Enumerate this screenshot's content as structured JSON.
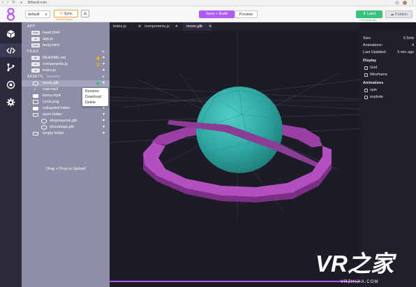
{
  "browser": {
    "url": "ilithwell.com",
    "nav_glyphs": [
      "‹",
      "›",
      "↻"
    ]
  },
  "toolbar": {
    "branch_select": "default",
    "sync_label": "Sync",
    "sync_subtext": "Needs Preview",
    "save_build_label": "Save + Build",
    "preview_label": "Preview",
    "land_label": "Land",
    "land_subtext": "x Five Branches",
    "publish_label": "Publish"
  },
  "rail": {
    "icons": [
      "cube-icon",
      "code-icon",
      "branch-icon",
      "target-icon",
      "gear-icon"
    ]
  },
  "panel": {
    "sections": {
      "app": "APP",
      "files": "FILES",
      "assets": "ASSETS",
      "assets_hint": "/assets/"
    },
    "app_files": [
      {
        "tag": "HTML",
        "name": "head.html"
      },
      {
        "tag": "JS",
        "name": "app.js"
      },
      {
        "tag": "HTML",
        "name": "body.html"
      }
    ],
    "files": [
      {
        "tag": "MD",
        "name": "README.md",
        "status_color": "#e8b21d"
      },
      {
        "tag": "JS",
        "name": "components.js",
        "status_color": "#e8b21d"
      },
      {
        "tag": "JS",
        "name": "index.js",
        "status_color": ""
      }
    ],
    "assets": [
      {
        "name": "moon.glb",
        "kind": "model",
        "status_color": "#3ac27a"
      },
      {
        "name": "roar.mp3",
        "kind": "audio"
      },
      {
        "name": "llama.mp4",
        "kind": "video"
      },
      {
        "name": "cycle.png",
        "kind": "image"
      },
      {
        "name": "collapsed folder",
        "kind": "folder"
      },
      {
        "name": "open folder",
        "kind": "folder"
      },
      {
        "name": "stegosaurus.glb",
        "kind": "model"
      },
      {
        "name": "triceratops.glb",
        "kind": "model"
      },
      {
        "name": "empty folder",
        "kind": "folder"
      }
    ],
    "drag_hint": "Drag + Drop to Upload",
    "plus": "+",
    "kebab": "▾"
  },
  "context_menu": [
    "Rename",
    "Download",
    "Delete"
  ],
  "tabs": [
    {
      "label": "index.js",
      "active": false
    },
    {
      "label": "components.js",
      "active": false
    },
    {
      "label": "moon.glb",
      "active": true
    }
  ],
  "tab_close": "✕",
  "properties": {
    "size_label": "Size:",
    "size_value": "5.5mb",
    "animations_label": "Animations:",
    "animations_value": "4",
    "updated_label": "Last Updated:",
    "updated_value": "5 min ago",
    "display_heading": "Display",
    "display_options": [
      "Grid",
      "Wireframe"
    ],
    "animations_heading": "Animations",
    "animation_options": [
      "spin",
      "explode"
    ]
  },
  "watermark": {
    "brand": "VR之家",
    "url": "VRZHIJIA.COM"
  },
  "colors": {
    "accent_purple": "#b05cf2",
    "accent_green": "#3ac27a",
    "sphere_teal": "#37b5ae",
    "ring_magenta": "#b44fc0"
  }
}
